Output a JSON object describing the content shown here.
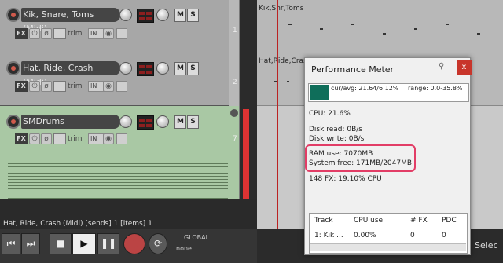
{
  "tracks": [
    {
      "name": "Kik, Snare, Toms (Midi)",
      "number": "1"
    },
    {
      "name": "Hat, Ride, Crash (Midi)",
      "number": "2"
    },
    {
      "name": "SMDrums",
      "number": "7"
    }
  ],
  "labels": {
    "mute": "M",
    "solo": "S",
    "fx": "FX",
    "trim": "trim",
    "in": "IN"
  },
  "lanes": [
    "Kik,Snr,Toms",
    "Hat,Ride,Crash"
  ],
  "status": "Hat, Ride, Crash (Midi) [sends] 1 [items] 1",
  "transport": {
    "global_label": "GLOBAL",
    "global_value": "none",
    "select_label": "Selec"
  },
  "performance_meter": {
    "title": "Performance Meter",
    "close": "x",
    "cur_avg": "cur/avg: 21.64/6.12%",
    "range": "range: 0.0-35.8%",
    "cpu": "CPU: 21.6%",
    "disk_read": "Disk read: 0B/s",
    "disk_write": "Disk write: 0B/s",
    "ram_use": "RAM use: 7070MB",
    "system_free": "System free: 171MB/2047MB",
    "fx": "148 FX: 19.10% CPU",
    "table": {
      "headers": [
        "Track",
        "CPU use",
        "# FX",
        "PDC"
      ],
      "row": [
        "1: Kik ...",
        "0.00%",
        "0",
        "0"
      ]
    }
  },
  "colors": {
    "accent_record": "#d05a4c",
    "highlight": "#e23d66",
    "selected_track": "#a9c8a4"
  }
}
